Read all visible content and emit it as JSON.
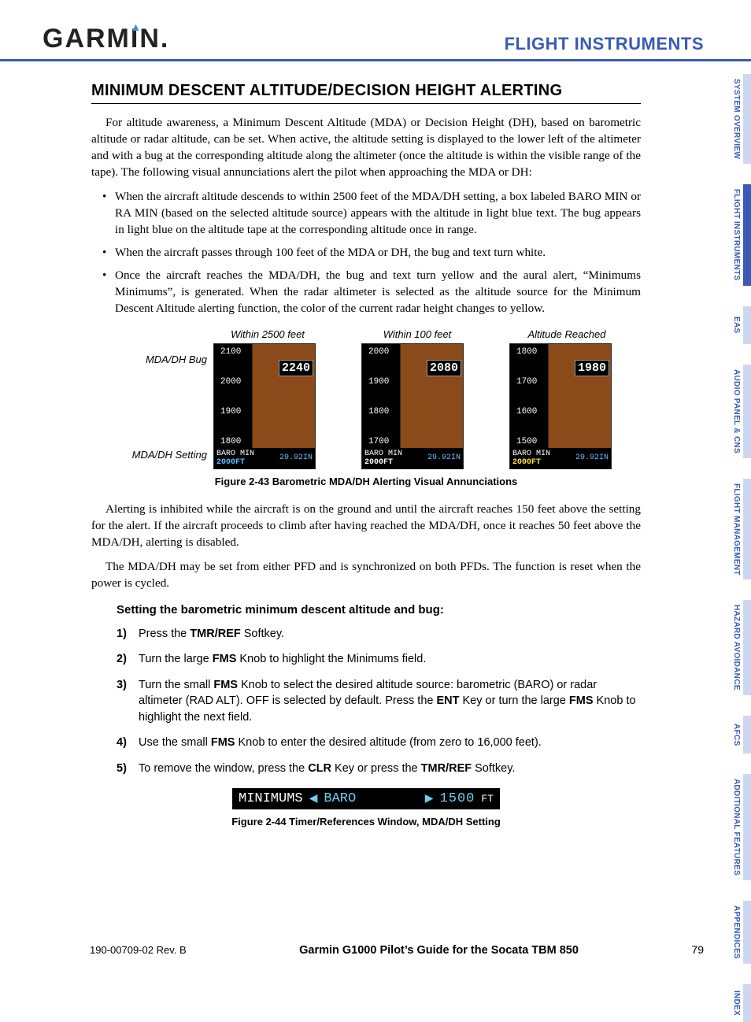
{
  "header": {
    "logo_text": "GARMIN",
    "section": "FLIGHT INSTRUMENTS"
  },
  "heading": "MINIMUM DESCENT ALTITUDE/DECISION HEIGHT ALERTING",
  "para1": "For altitude awareness, a Minimum Descent Altitude (MDA) or Decision Height (DH), based on barometric altitude or radar altitude, can be set.  When active, the altitude setting is displayed to the lower left of the altimeter and with a bug at the corresponding altitude along the altimeter (once the altitude is within the visible range of the tape).  The following visual annunciations alert the pilot when approaching the MDA or DH:",
  "bullets": [
    "When the aircraft altitude descends to within 2500 feet of the MDA/DH setting, a box labeled BARO MIN or RA MIN (based on the selected altitude source) appears with the altitude in light blue text.  The bug appears in light blue on the altitude tape at the corresponding altitude once in range.",
    "When the aircraft passes through 100 feet of the MDA or DH, the bug and text turn white.",
    "Once the aircraft reaches the MDA/DH, the bug and text turn yellow and the aural alert, “Minimums Minimums”, is generated.  When the radar altimeter is selected as the altitude source for the Minimum Descent Altitude alerting function, the color of the current radar height changes to yellow."
  ],
  "fig43": {
    "top_labels": [
      "Within 2500 feet",
      "Within 100 feet",
      "Altitude Reached"
    ],
    "side_bug": "MDA/DH Bug",
    "side_set": "MDA/DH Setting",
    "tapes": [
      {
        "cur": "2240",
        "scale": [
          "2100",
          "2000",
          "1900",
          "1800"
        ],
        "baro_label": "BARO MIN",
        "alt": "2000FT",
        "prs": "29.92IN",
        "alt_class": "lb"
      },
      {
        "cur": "2080",
        "scale": [
          "2000",
          "1900",
          "1800",
          "1700"
        ],
        "baro_label": "BARO MIN",
        "alt": "2000FT",
        "prs": "29.92IN",
        "alt_class": "wh"
      },
      {
        "cur": "1980",
        "scale": [
          "1800",
          "1700",
          "1600",
          "1500"
        ],
        "baro_label": "BARO MIN",
        "alt": "2000FT",
        "prs": "29.92IN",
        "alt_class": "yl"
      }
    ],
    "caption": "Figure 2-43  Barometric MDA/DH Alerting Visual Annunciations"
  },
  "para2": "Alerting is inhibited while the aircraft is on the ground and until the aircraft reaches 150 feet above the setting for the alert.  If the aircraft proceeds to climb after having reached the MDA/DH, once it reaches 50 feet above the MDA/DH, alerting is disabled.",
  "para3": "The MDA/DH may be set from either PFD and is synchronized on both PFDs.  The function is reset when the power is cycled.",
  "proc_heading": "Setting the barometric minimum descent altitude and bug:",
  "steps": {
    "s1a": "Press the ",
    "s1b": "TMR/REF",
    "s1c": " Softkey.",
    "s2a": "Turn the large ",
    "s2b": "FMS",
    "s2c": " Knob to highlight the Minimums field.",
    "s3a": "Turn the small ",
    "s3b": "FMS",
    "s3c": " Knob to select the desired altitude source: barometric (BARO)  or radar altimeter (RAD ALT).  OFF is selected by default.  Press the ",
    "s3d": "ENT",
    "s3e": " Key or turn the large ",
    "s3f": "FMS",
    "s3g": " Knob to highlight the next field.",
    "s4a": "Use the small ",
    "s4b": "FMS",
    "s4c": " Knob to enter the desired altitude (from zero to 16,000 feet).",
    "s5a": "To remove the window, press the ",
    "s5b": "CLR",
    "s5c": " Key or press the ",
    "s5d": "TMR/REF",
    "s5e": " Softkey."
  },
  "fig44": {
    "label": "MINIMUMS",
    "sel": "BARO",
    "val": "1500",
    "unit": "FT",
    "caption": "Figure 2-44  Timer/References Window, MDA/DH Setting"
  },
  "tabs": [
    "SYSTEM OVERVIEW",
    "FLIGHT INSTRUMENTS",
    "EAS",
    "AUDIO PANEL & CNS",
    "FLIGHT MANAGEMENT",
    "HAZARD AVOIDANCE",
    "AFCS",
    "ADDITIONAL FEATURES",
    "APPENDICES",
    "INDEX"
  ],
  "footer": {
    "doc": "190-00709-02  Rev. B",
    "guide": "Garmin G1000 Pilot’s Guide for the Socata TBM 850",
    "page": "79"
  }
}
